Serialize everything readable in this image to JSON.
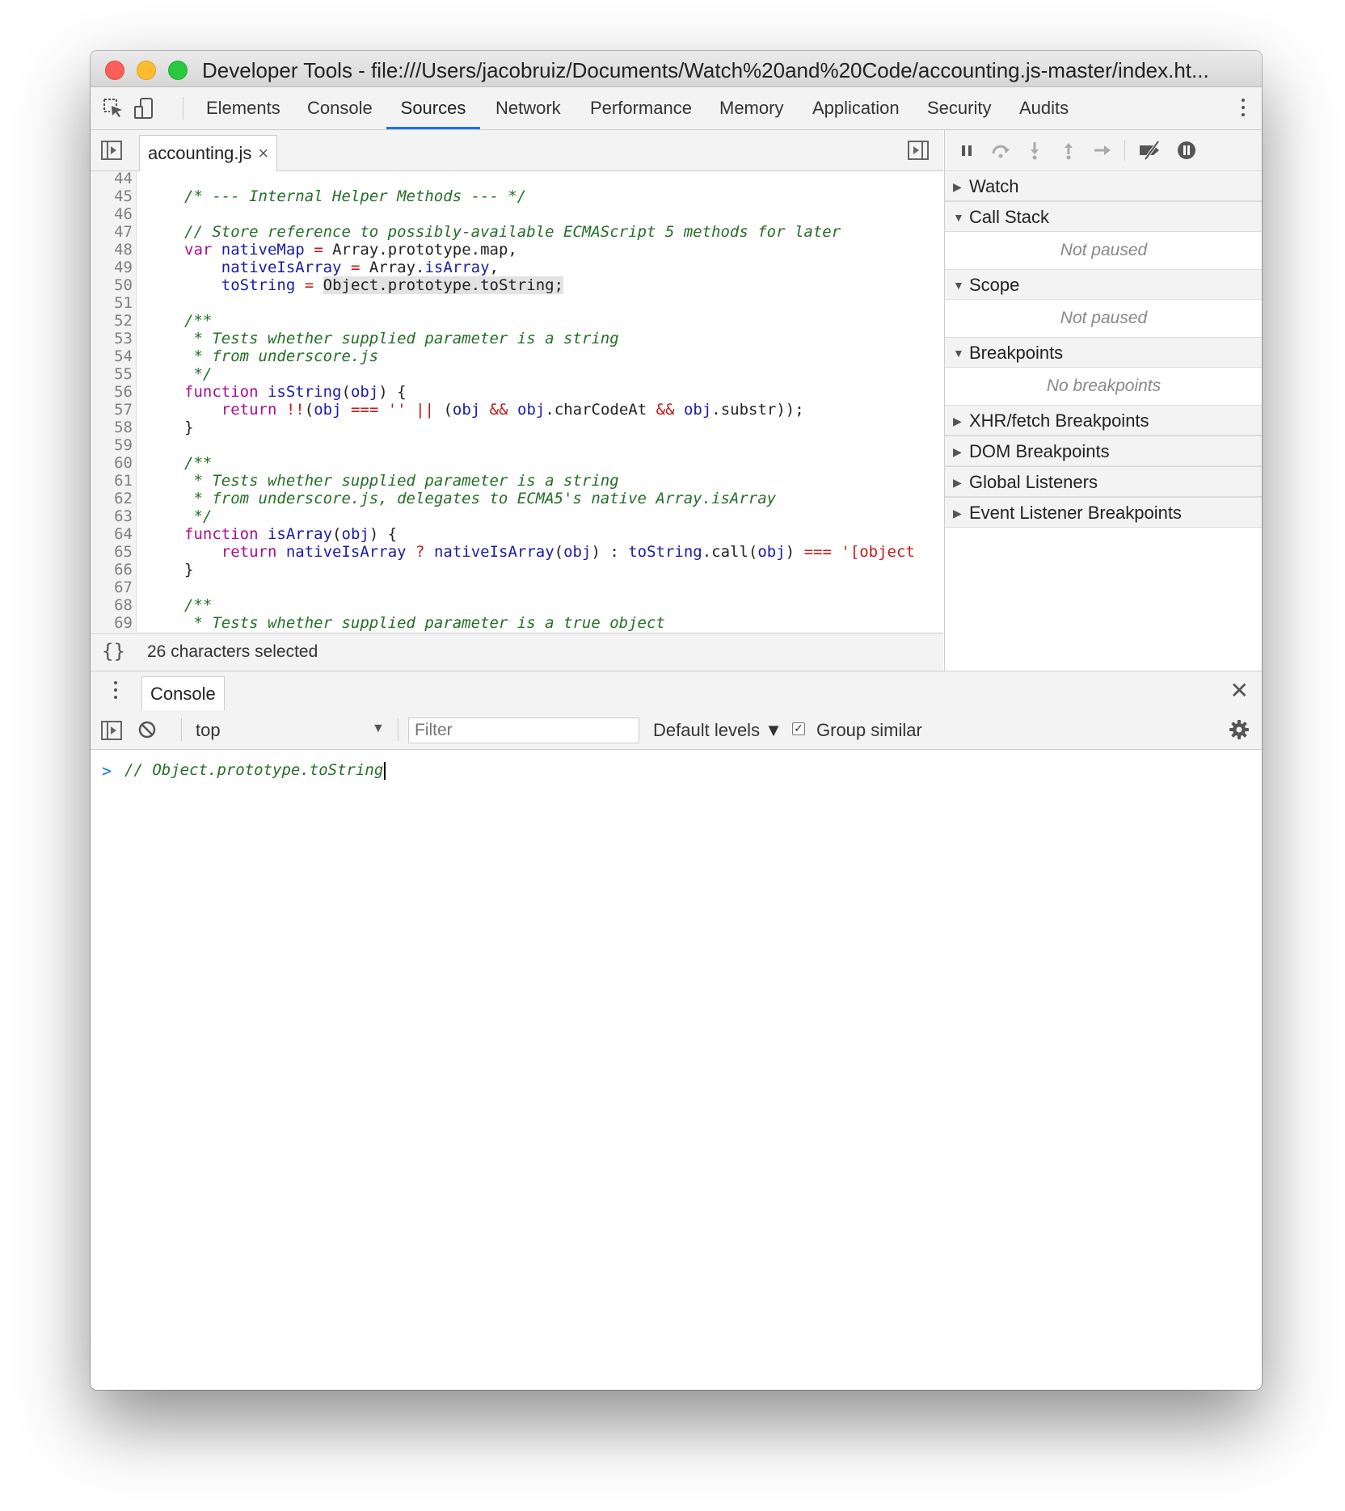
{
  "window": {
    "title": "Developer Tools - file:///Users/jacobruiz/Documents/Watch%20and%20Code/accounting.js-master/index.ht..."
  },
  "main_tabs": [
    "Elements",
    "Console",
    "Sources",
    "Network",
    "Performance",
    "Memory",
    "Application",
    "Security",
    "Audits"
  ],
  "active_tab": "Sources",
  "sources": {
    "file_tab": "accounting.js",
    "close_glyph": "×",
    "status": "26 characters selected",
    "format_glyph": "{}"
  },
  "code": {
    "line_numbers": [
      "44",
      "45",
      "46",
      "47",
      "48",
      "49",
      "50",
      "51",
      "52",
      "53",
      "54",
      "55",
      "56",
      "57",
      "58",
      "59",
      "60",
      "61",
      "62",
      "63",
      "64",
      "65",
      "66",
      "67",
      "68",
      "69"
    ],
    "lines": [
      "",
      "/* --- Internal Helper Methods --- */",
      "",
      "// Store reference to possibly-available ECMAScript 5 methods for later",
      "var nativeMap = Array.prototype.map,",
      "    nativeIsArray = Array.isArray,",
      "    toString = Object.prototype.toString;",
      "",
      "/**",
      " * Tests whether supplied parameter is a string",
      " * from underscore.js",
      " */",
      "function isString(obj) {",
      "    return !!(obj === '' || (obj && obj.charCodeAt && obj.substr));",
      "}",
      "",
      "/**",
      " * Tests whether supplied parameter is a string",
      " * from underscore.js, delegates to ECMA5's native Array.isArray",
      " */",
      "function isArray(obj) {",
      "    return nativeIsArray ? nativeIsArray(obj) : toString.call(obj) === '[object",
      "}",
      "",
      "/**",
      " * Tests whether supplied parameter is a true object"
    ]
  },
  "debugger": {
    "panes": [
      {
        "label": "Watch",
        "expanded": false
      },
      {
        "label": "Call Stack",
        "expanded": true,
        "body": "Not paused"
      },
      {
        "label": "Scope",
        "expanded": true,
        "body": "Not paused"
      },
      {
        "label": "Breakpoints",
        "expanded": true,
        "body": "No breakpoints"
      },
      {
        "label": "XHR/fetch Breakpoints",
        "expanded": false
      },
      {
        "label": "DOM Breakpoints",
        "expanded": false
      },
      {
        "label": "Global Listeners",
        "expanded": false
      },
      {
        "label": "Event Listener Breakpoints",
        "expanded": false
      }
    ]
  },
  "drawer": {
    "tab": "Console",
    "close_glyph": "✕",
    "context": "top",
    "filter_placeholder": "Filter",
    "levels": "Default levels ▼",
    "group_similar": "Group similar",
    "group_similar_checked": true,
    "prompt": ">",
    "input_text": "// Object.prototype.toString"
  },
  "colors": {
    "accent": "#1a73e8",
    "comment": "#236e25",
    "keyword": "#aa0d91",
    "variable": "#1a1aa6",
    "operator": "#c41a16"
  }
}
